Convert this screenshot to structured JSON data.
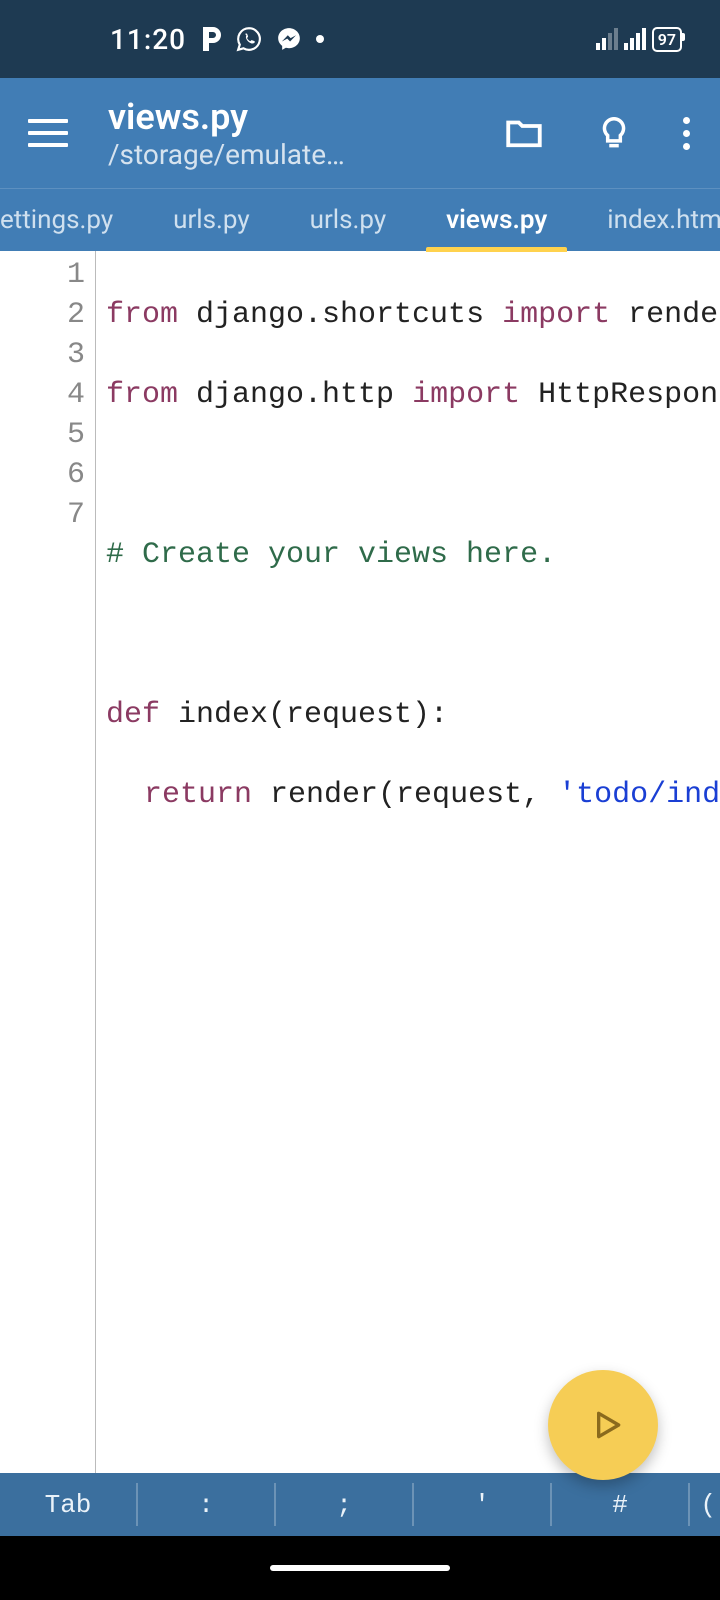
{
  "status": {
    "time": "11:20",
    "battery": "97"
  },
  "appbar": {
    "title": "views.py",
    "subtitle": "/storage/emulate…"
  },
  "tabs": {
    "items": [
      {
        "label": "ettings.py",
        "partial": true
      },
      {
        "label": "urls.py"
      },
      {
        "label": "urls.py"
      },
      {
        "label": "views.py",
        "active": true
      },
      {
        "label": "index.html"
      }
    ]
  },
  "code": {
    "lines": [
      "1",
      "2",
      "3",
      "4",
      "5",
      "6",
      "7"
    ],
    "tokens": {
      "l1_kw1": "from",
      "l1_t1": " django.shortcuts ",
      "l1_kw2": "import",
      "l1_t2": " render",
      "l2_kw1": "from",
      "l2_t1": " django.http ",
      "l2_kw2": "import",
      "l2_t2": " HttpResponse",
      "l4_cm": "# Create your views here.",
      "l6_kw": "def",
      "l6_t": " index(request):",
      "l7_kw": "return",
      "l7_t1": " render(request, ",
      "l7_str": "'todo/index.html'",
      "l7_t2": ")"
    }
  },
  "keys": {
    "k0": "Tab",
    "k1": ":",
    "k2": ";",
    "k3": "'",
    "k4": "#",
    "k5": "("
  }
}
